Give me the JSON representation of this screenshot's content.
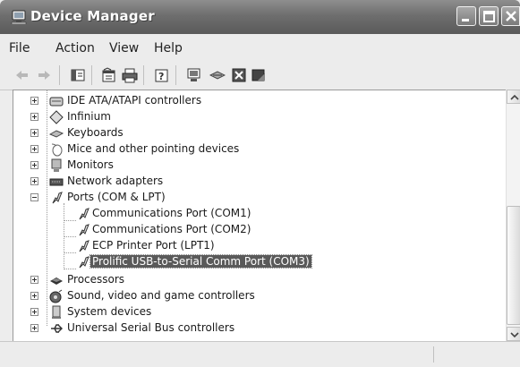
{
  "window": {
    "title": "Device Manager",
    "title_icon": "computer-monitor-icon"
  },
  "menubar": {
    "items": [
      "File",
      "Action",
      "View",
      "Help"
    ]
  },
  "toolbar": {
    "icons": [
      "back-arrow-icon",
      "forward-arrow-icon",
      "show-hide-console-tree-icon",
      "properties-icon",
      "print-icon",
      "help-icon",
      "scan-hardware-icon",
      "update-driver-icon",
      "uninstall-icon",
      "disable-icon"
    ]
  },
  "tree": {
    "items": [
      {
        "label": "IDE ATA/ATAPI controllers",
        "icon": "ide-controller-icon",
        "level": 0,
        "expander": "plus"
      },
      {
        "label": "Infinium",
        "icon": "infinium-device-icon",
        "level": 0,
        "expander": "plus"
      },
      {
        "label": "Keyboards",
        "icon": "keyboard-icon",
        "level": 0,
        "expander": "plus"
      },
      {
        "label": "Mice and other pointing devices",
        "icon": "mouse-icon",
        "level": 0,
        "expander": "plus"
      },
      {
        "label": "Monitors",
        "icon": "monitor-icon",
        "level": 0,
        "expander": "plus"
      },
      {
        "label": "Network adapters",
        "icon": "network-adapter-icon",
        "level": 0,
        "expander": "plus"
      },
      {
        "label": "Ports (COM & LPT)",
        "icon": "port-connector-icon",
        "level": 0,
        "expander": "minus"
      },
      {
        "label": "Communications Port (COM1)",
        "icon": "port-connector-icon",
        "level": 1
      },
      {
        "label": "Communications Port (COM2)",
        "icon": "port-connector-icon",
        "level": 1
      },
      {
        "label": "ECP Printer Port (LPT1)",
        "icon": "port-connector-icon",
        "level": 1
      },
      {
        "label": "Prolific USB-to-Serial Comm Port (COM3)",
        "icon": "port-connector-icon",
        "level": 1,
        "selected": true
      },
      {
        "label": "Processors",
        "icon": "processor-icon",
        "level": 0,
        "expander": "plus"
      },
      {
        "label": "Sound, video and game controllers",
        "icon": "sound-icon",
        "level": 0,
        "expander": "plus"
      },
      {
        "label": "System devices",
        "icon": "system-device-icon",
        "level": 0,
        "expander": "plus"
      },
      {
        "label": "Universal Serial Bus controllers",
        "icon": "usb-icon",
        "level": 0,
        "expander": "plus"
      }
    ]
  },
  "scrollbar": {
    "up_icon": "chevron-up-icon",
    "down_icon": "chevron-down-icon"
  }
}
